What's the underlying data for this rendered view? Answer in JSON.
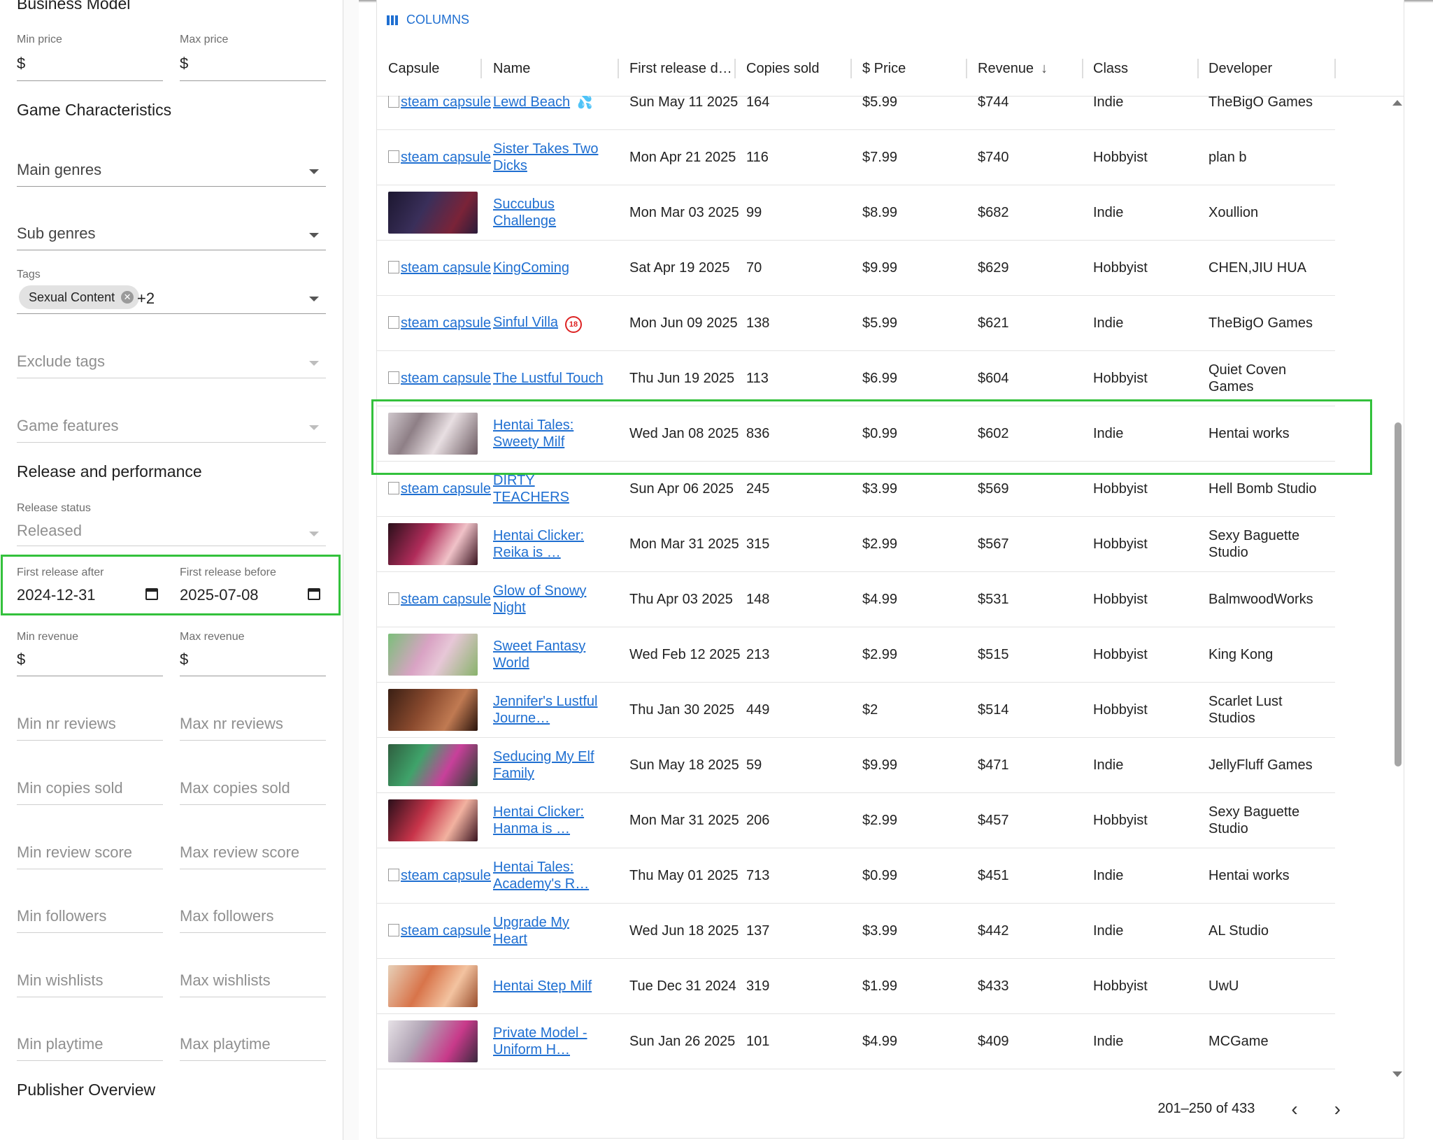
{
  "sidebar": {
    "business_model": "Business Model",
    "min_price": {
      "label": "Min price",
      "value": "$"
    },
    "max_price": {
      "label": "Max price",
      "value": "$"
    },
    "game_characteristics": "Game Characteristics",
    "main_genres": "Main genres",
    "sub_genres": "Sub genres",
    "tags": {
      "label": "Tags",
      "chip": "Sexual Content",
      "more": "+2"
    },
    "exclude_tags": "Exclude tags",
    "game_features": "Game features",
    "release_performance": "Release and performance",
    "release_status": {
      "label": "Release status",
      "value": "Released"
    },
    "first_release_after": {
      "label": "First release after",
      "value": "2024-12-31"
    },
    "first_release_before": {
      "label": "First release before",
      "value": "2025-07-08"
    },
    "min_revenue": {
      "label": "Min revenue",
      "value": "$"
    },
    "max_revenue": {
      "label": "Max revenue",
      "value": "$"
    },
    "min_nr_reviews": "Min nr reviews",
    "max_nr_reviews": "Max nr reviews",
    "min_copies_sold": "Min copies sold",
    "max_copies_sold": "Max copies sold",
    "min_review_score": "Min review score",
    "max_review_score": "Max review score",
    "min_followers": "Min followers",
    "max_followers": "Max followers",
    "min_wishlists": "Min wishlists",
    "max_wishlists": "Max wishlists",
    "min_playtime": "Min playtime",
    "max_playtime": "Max playtime",
    "publisher_overview": "Publisher Overview"
  },
  "table": {
    "columns_button": "COLUMNS",
    "headers": {
      "capsule": "Capsule",
      "name": "Name",
      "first_release": "First release d…",
      "copies_sold": "Copies sold",
      "price": "$ Price",
      "revenue": "Revenue",
      "class": "Class",
      "developer": "Developer"
    },
    "broken_capsule": "steam capsule",
    "rows": [
      {
        "name": "Lewd Beach",
        "date": "Sun May 11 2025",
        "copies": "164",
        "price": "$5.99",
        "revenue": "$744",
        "class": "Indie",
        "developer": "TheBigO Games"
      },
      {
        "name": "Sister Takes Two Dicks",
        "date": "Mon Apr 21 2025",
        "copies": "116",
        "price": "$7.99",
        "revenue": "$740",
        "class": "Hobbyist",
        "developer": "plan b"
      },
      {
        "name": "Succubus Challenge",
        "date": "Mon Mar 03 2025",
        "copies": "99",
        "price": "$8.99",
        "revenue": "$682",
        "class": "Indie",
        "developer": "Xoullion"
      },
      {
        "name": "KingComing",
        "date": "Sat Apr 19 2025",
        "copies": "70",
        "price": "$9.99",
        "revenue": "$629",
        "class": "Hobbyist",
        "developer": "CHEN,JIU HUA"
      },
      {
        "name": "Sinful Villa",
        "date": "Mon Jun 09 2025",
        "copies": "138",
        "price": "$5.99",
        "revenue": "$621",
        "class": "Indie",
        "developer": "TheBigO Games"
      },
      {
        "name": "The Lustful Touch",
        "date": "Thu Jun 19 2025",
        "copies": "113",
        "price": "$6.99",
        "revenue": "$604",
        "class": "Hobbyist",
        "developer": "Quiet Coven Games"
      },
      {
        "name": "Hentai Tales: Sweety Milf",
        "date": "Wed Jan 08 2025",
        "copies": "836",
        "price": "$0.99",
        "revenue": "$602",
        "class": "Indie",
        "developer": "Hentai works"
      },
      {
        "name": "DIRTY TEACHERS",
        "date": "Sun Apr 06 2025",
        "copies": "245",
        "price": "$3.99",
        "revenue": "$569",
        "class": "Hobbyist",
        "developer": "Hell Bomb Studio"
      },
      {
        "name": "Hentai Clicker: Reika is …",
        "date": "Mon Mar 31 2025",
        "copies": "315",
        "price": "$2.99",
        "revenue": "$567",
        "class": "Hobbyist",
        "developer": "Sexy Baguette Studio"
      },
      {
        "name": "Glow of Snowy Night",
        "date": "Thu Apr 03 2025",
        "copies": "148",
        "price": "$4.99",
        "revenue": "$531",
        "class": "Hobbyist",
        "developer": "BalmwoodWorks"
      },
      {
        "name": "Sweet Fantasy World",
        "date": "Wed Feb 12 2025",
        "copies": "213",
        "price": "$2.99",
        "revenue": "$515",
        "class": "Hobbyist",
        "developer": "King Kong"
      },
      {
        "name": "Jennifer's Lustful Journe…",
        "date": "Thu Jan 30 2025",
        "copies": "449",
        "price": "$2",
        "revenue": "$514",
        "class": "Hobbyist",
        "developer": "Scarlet Lust Studios"
      },
      {
        "name": "Seducing My Elf Family",
        "date": "Sun May 18 2025",
        "copies": "59",
        "price": "$9.99",
        "revenue": "$471",
        "class": "Indie",
        "developer": "JellyFluff Games"
      },
      {
        "name": "Hentai Clicker: Hanma is …",
        "date": "Mon Mar 31 2025",
        "copies": "206",
        "price": "$2.99",
        "revenue": "$457",
        "class": "Hobbyist",
        "developer": "Sexy Baguette Studio"
      },
      {
        "name": "Hentai Tales: Academy's R…",
        "date": "Thu May 01 2025",
        "copies": "713",
        "price": "$0.99",
        "revenue": "$451",
        "class": "Indie",
        "developer": "Hentai works"
      },
      {
        "name": "Upgrade My Heart",
        "date": "Wed Jun 18 2025",
        "copies": "137",
        "price": "$3.99",
        "revenue": "$442",
        "class": "Indie",
        "developer": "AL Studio"
      },
      {
        "name": "Hentai Step Milf",
        "date": "Tue Dec 31 2024",
        "copies": "319",
        "price": "$1.99",
        "revenue": "$433",
        "class": "Hobbyist",
        "developer": "UwU"
      },
      {
        "name": "Private Model - Uniform H…",
        "date": "Sun Jan 26 2025",
        "copies": "101",
        "price": "$4.99",
        "revenue": "$409",
        "class": "Indie",
        "developer": "MCGame"
      }
    ],
    "pagination": "201–250 of 433"
  },
  "colors": {
    "accent": "#1f6fd1",
    "highlight": "#33c13c"
  }
}
